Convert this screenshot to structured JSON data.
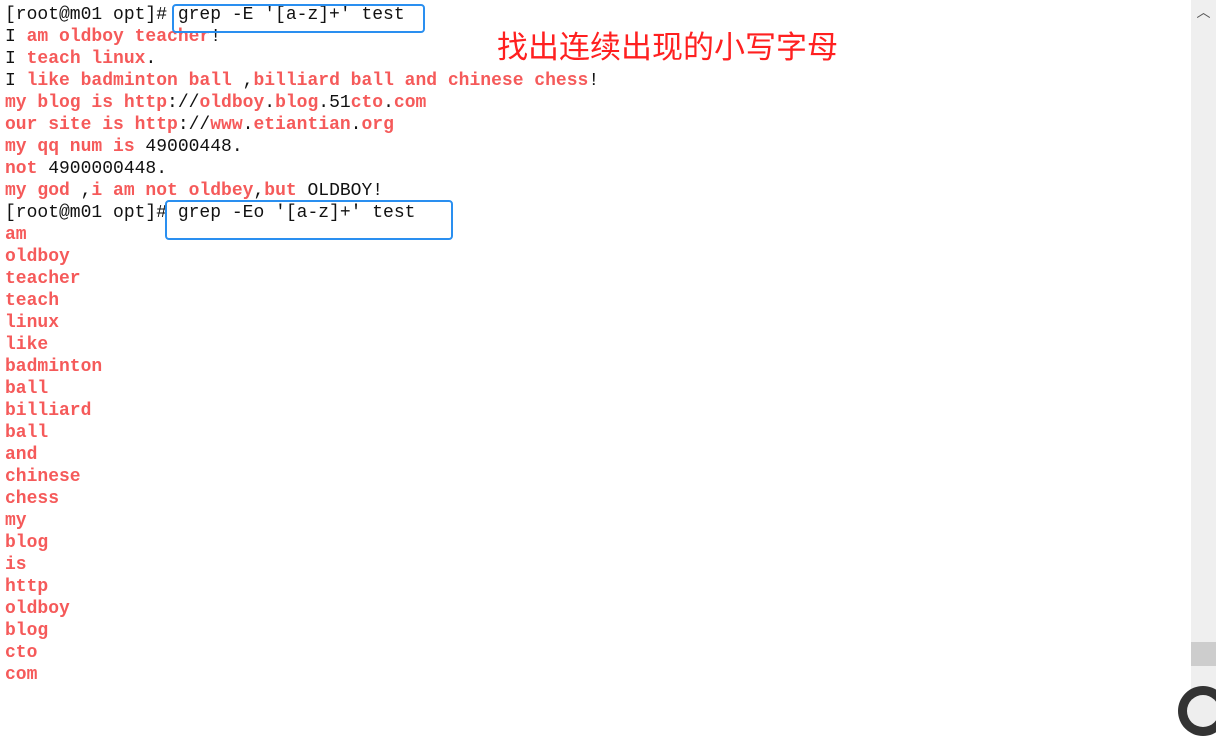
{
  "annotation": "找出连续出现的小写字母",
  "colors": {
    "match": "#f55a5a",
    "box": "#2a8ff0",
    "annotation": "#ff2020"
  },
  "terminal_lines": [
    [
      {
        "t": "[root@m01 opt]# grep -E '[a-z]+' test",
        "hl": false
      }
    ],
    [
      {
        "t": "I ",
        "hl": false
      },
      {
        "t": "am oldboy teacher",
        "hl": true
      },
      {
        "t": "!",
        "hl": false
      }
    ],
    [
      {
        "t": "I ",
        "hl": false
      },
      {
        "t": "teach linux",
        "hl": true
      },
      {
        "t": ".",
        "hl": false
      }
    ],
    [
      {
        "t": "I ",
        "hl": false
      },
      {
        "t": "like badminton ball",
        "hl": true
      },
      {
        "t": " ,",
        "hl": false
      },
      {
        "t": "billiard ball and chinese chess",
        "hl": true
      },
      {
        "t": "!",
        "hl": false
      }
    ],
    [
      {
        "t": "my blog is http",
        "hl": true
      },
      {
        "t": "://",
        "hl": false
      },
      {
        "t": "oldboy",
        "hl": true
      },
      {
        "t": ".",
        "hl": false
      },
      {
        "t": "blog",
        "hl": true
      },
      {
        "t": ".51",
        "hl": false
      },
      {
        "t": "cto",
        "hl": true
      },
      {
        "t": ".",
        "hl": false
      },
      {
        "t": "com",
        "hl": true
      }
    ],
    [
      {
        "t": "our site is http",
        "hl": true
      },
      {
        "t": "://",
        "hl": false
      },
      {
        "t": "www",
        "hl": true
      },
      {
        "t": ".",
        "hl": false
      },
      {
        "t": "etiantian",
        "hl": true
      },
      {
        "t": ".",
        "hl": false
      },
      {
        "t": "org",
        "hl": true
      }
    ],
    [
      {
        "t": "my qq num is",
        "hl": true
      },
      {
        "t": " 49000448.",
        "hl": false
      }
    ],
    [
      {
        "t": "not",
        "hl": true
      },
      {
        "t": " 4900000448.",
        "hl": false
      }
    ],
    [
      {
        "t": "my god",
        "hl": true
      },
      {
        "t": " ,",
        "hl": false
      },
      {
        "t": "i am not oldbey",
        "hl": true
      },
      {
        "t": ",",
        "hl": false
      },
      {
        "t": "but",
        "hl": true
      },
      {
        "t": " OLDBOY!",
        "hl": false
      }
    ],
    [
      {
        "t": "[root@m01 opt]# grep -Eo '[a-z]+' test",
        "hl": false
      }
    ],
    [
      {
        "t": "am",
        "hl": true
      }
    ],
    [
      {
        "t": "oldboy",
        "hl": true
      }
    ],
    [
      {
        "t": "teacher",
        "hl": true
      }
    ],
    [
      {
        "t": "teach",
        "hl": true
      }
    ],
    [
      {
        "t": "linux",
        "hl": true
      }
    ],
    [
      {
        "t": "like",
        "hl": true
      }
    ],
    [
      {
        "t": "badminton",
        "hl": true
      }
    ],
    [
      {
        "t": "ball",
        "hl": true
      }
    ],
    [
      {
        "t": "billiard",
        "hl": true
      }
    ],
    [
      {
        "t": "ball",
        "hl": true
      }
    ],
    [
      {
        "t": "and",
        "hl": true
      }
    ],
    [
      {
        "t": "chinese",
        "hl": true
      }
    ],
    [
      {
        "t": "chess",
        "hl": true
      }
    ],
    [
      {
        "t": "my",
        "hl": true
      }
    ],
    [
      {
        "t": "blog",
        "hl": true
      }
    ],
    [
      {
        "t": "is",
        "hl": true
      }
    ],
    [
      {
        "t": "http",
        "hl": true
      }
    ],
    [
      {
        "t": "oldboy",
        "hl": true
      }
    ],
    [
      {
        "t": "blog",
        "hl": true
      }
    ],
    [
      {
        "t": "cto",
        "hl": true
      }
    ],
    [
      {
        "t": "com",
        "hl": true
      }
    ]
  ],
  "scrollbar": {
    "up_arrow": "︿",
    "position": 0.97
  }
}
